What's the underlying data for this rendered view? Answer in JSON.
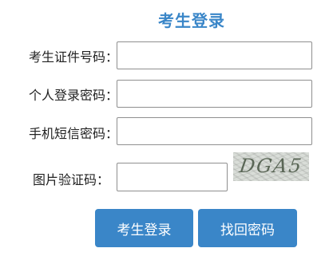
{
  "page": {
    "title": "考生登录"
  },
  "form": {
    "fields": [
      {
        "label": "考生证件号码：",
        "value": "",
        "placeholder": ""
      },
      {
        "label": "个人登录密码：",
        "value": "",
        "placeholder": ""
      },
      {
        "label": "手机短信密码：",
        "value": "",
        "placeholder": ""
      },
      {
        "label": "图片验证码：",
        "value": "",
        "placeholder": ""
      }
    ],
    "captcha_text": "DGA5"
  },
  "buttons": {
    "login": "考生登录",
    "recover": "找回密码"
  },
  "colors": {
    "accent": "#3a86c8",
    "border": "#8f8f8f",
    "captcha_bg": "#d9ddd8"
  }
}
